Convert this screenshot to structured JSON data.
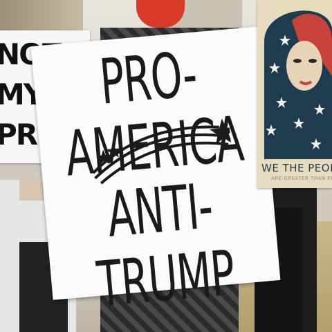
{
  "left_sign": {
    "text_lines": [
      "NOT MY",
      "PRESI"
    ]
  },
  "main_sign": {
    "line1": "PRO-AMERICA",
    "line2": "ANTI-TRUMP"
  },
  "poster": {
    "caption": "WE THE PEOPLE",
    "subcaption": "ARE GREATER THAN FEAR"
  },
  "colors": {
    "scarf": "#d83a2a",
    "poster_blue": "#1e3b4f",
    "poster_red": "#c9423a",
    "sign_ink": "#1a1a1a"
  }
}
